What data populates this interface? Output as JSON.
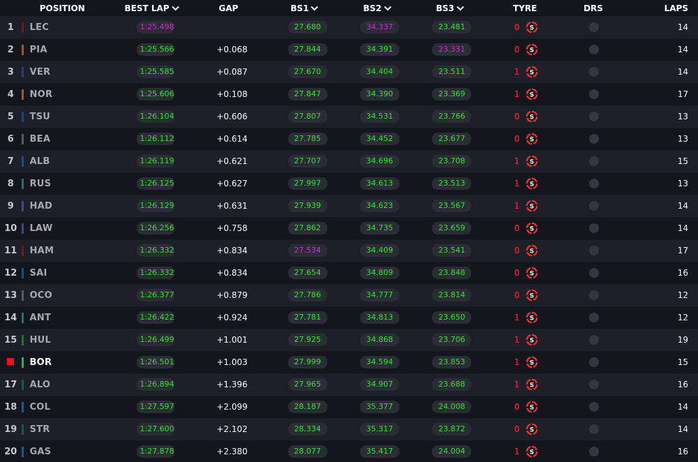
{
  "columns": {
    "position": "POSITION",
    "best_lap": "BEST LAP",
    "gap": "GAP",
    "bs1": "BS1",
    "bs2": "BS2",
    "bs3": "BS3",
    "tyre": "TYRE",
    "drs": "DRS",
    "laps": "LAPS"
  },
  "colors": {
    "green": "#2ce62c",
    "purple": "#d22ad2",
    "tyre_soft": "#ff3030",
    "current_driver_marker": "#ff1010"
  },
  "rows": [
    {
      "pos": "1",
      "team_color": "#7a1020",
      "driver": "LEC",
      "best": "1:25.498",
      "best_c": "purple",
      "gap": "",
      "bs1": "27.680",
      "bs1_c": "green",
      "bs2": "34.337",
      "bs2_c": "purple",
      "bs3": "23.481",
      "bs3_c": "green",
      "tyre_age": "0",
      "tyre_icon": "soft-tyre-icon",
      "laps": "14"
    },
    {
      "pos": "2",
      "team_color": "#a85a10",
      "driver": "PIA",
      "best": "1:25.566",
      "best_c": "green",
      "gap": "+0.068",
      "bs1": "27.844",
      "bs1_c": "green",
      "bs2": "34.391",
      "bs2_c": "green",
      "bs3": "23.331",
      "bs3_c": "purple",
      "tyre_age": "0",
      "tyre_icon": "soft-tyre-icon",
      "laps": "14"
    },
    {
      "pos": "3",
      "team_color": "#24407a",
      "driver": "VER",
      "best": "1:25.585",
      "best_c": "green",
      "gap": "+0.087",
      "bs1": "27.670",
      "bs1_c": "green",
      "bs2": "34.404",
      "bs2_c": "green",
      "bs3": "23.511",
      "bs3_c": "green",
      "tyre_age": "1",
      "tyre_icon": "soft-tyre-icon",
      "laps": "14"
    },
    {
      "pos": "4",
      "team_color": "#a85a10",
      "driver": "NOR",
      "best": "1:25.606",
      "best_c": "green",
      "gap": "+0.108",
      "bs1": "27.847",
      "bs1_c": "green",
      "bs2": "34.390",
      "bs2_c": "green",
      "bs3": "23.369",
      "bs3_c": "green",
      "tyre_age": "1",
      "tyre_icon": "soft-tyre-icon",
      "laps": "17"
    },
    {
      "pos": "5",
      "team_color": "#24407a",
      "driver": "TSU",
      "best": "1:26.104",
      "best_c": "green",
      "gap": "+0.606",
      "bs1": "27.807",
      "bs1_c": "green",
      "bs2": "34.531",
      "bs2_c": "green",
      "bs3": "23.766",
      "bs3_c": "green",
      "tyre_age": "0",
      "tyre_icon": "soft-tyre-icon",
      "laps": "13"
    },
    {
      "pos": "6",
      "team_color": "#5a5a62",
      "driver": "BEA",
      "best": "1:26.112",
      "best_c": "green",
      "gap": "+0.614",
      "bs1": "27.785",
      "bs1_c": "green",
      "bs2": "34.452",
      "bs2_c": "green",
      "bs3": "23.677",
      "bs3_c": "green",
      "tyre_age": "0",
      "tyre_icon": "soft-tyre-icon",
      "laps": "13"
    },
    {
      "pos": "7",
      "team_color": "#1e4a8a",
      "driver": "ALB",
      "best": "1:26.119",
      "best_c": "green",
      "gap": "+0.621",
      "bs1": "27.707",
      "bs1_c": "green",
      "bs2": "34.696",
      "bs2_c": "green",
      "bs3": "23.708",
      "bs3_c": "green",
      "tyre_age": "1",
      "tyre_icon": "soft-tyre-icon",
      "laps": "15"
    },
    {
      "pos": "8",
      "team_color": "#147a6a",
      "driver": "RUS",
      "best": "1:26.125",
      "best_c": "green",
      "gap": "+0.627",
      "bs1": "27.997",
      "bs1_c": "green",
      "bs2": "34.613",
      "bs2_c": "green",
      "bs3": "23.513",
      "bs3_c": "green",
      "tyre_age": "1",
      "tyre_icon": "soft-tyre-icon",
      "laps": "13"
    },
    {
      "pos": "9",
      "team_color": "#3a4a8a",
      "driver": "HAD",
      "best": "1:26.129",
      "best_c": "green",
      "gap": "+0.631",
      "bs1": "27.939",
      "bs1_c": "green",
      "bs2": "34.623",
      "bs2_c": "green",
      "bs3": "23.567",
      "bs3_c": "green",
      "tyre_age": "1",
      "tyre_icon": "soft-tyre-icon",
      "laps": "14"
    },
    {
      "pos": "10",
      "team_color": "#3a4a8a",
      "driver": "LAW",
      "best": "1:26.256",
      "best_c": "green",
      "gap": "+0.758",
      "bs1": "27.862",
      "bs1_c": "green",
      "bs2": "34.735",
      "bs2_c": "green",
      "bs3": "23.659",
      "bs3_c": "green",
      "tyre_age": "0",
      "tyre_icon": "soft-tyre-icon",
      "laps": "14"
    },
    {
      "pos": "11",
      "team_color": "#7a1020",
      "driver": "HAM",
      "best": "1:26.332",
      "best_c": "green",
      "gap": "+0.834",
      "bs1": "27.534",
      "bs1_c": "purple",
      "bs2": "34.409",
      "bs2_c": "green",
      "bs3": "23.541",
      "bs3_c": "green",
      "tyre_age": "0",
      "tyre_icon": "soft-tyre-icon",
      "laps": "17"
    },
    {
      "pos": "12",
      "team_color": "#1e4a8a",
      "driver": "SAI",
      "best": "1:26.332",
      "best_c": "green",
      "gap": "+0.834",
      "bs1": "27.654",
      "bs1_c": "green",
      "bs2": "34.809",
      "bs2_c": "green",
      "bs3": "23.848",
      "bs3_c": "green",
      "tyre_age": "0",
      "tyre_icon": "soft-tyre-icon",
      "laps": "16"
    },
    {
      "pos": "13",
      "team_color": "#5a5a62",
      "driver": "OCO",
      "best": "1:26.377",
      "best_c": "green",
      "gap": "+0.879",
      "bs1": "27.786",
      "bs1_c": "green",
      "bs2": "34.777",
      "bs2_c": "green",
      "bs3": "23.814",
      "bs3_c": "green",
      "tyre_age": "0",
      "tyre_icon": "soft-tyre-icon",
      "laps": "12"
    },
    {
      "pos": "14",
      "team_color": "#147a6a",
      "driver": "ANT",
      "best": "1:26.422",
      "best_c": "green",
      "gap": "+0.924",
      "bs1": "27.781",
      "bs1_c": "green",
      "bs2": "34.813",
      "bs2_c": "green",
      "bs3": "23.650",
      "bs3_c": "green",
      "tyre_age": "1",
      "tyre_icon": "soft-tyre-icon",
      "laps": "12"
    },
    {
      "pos": "15",
      "team_color": "#1a7a2a",
      "driver": "HUL",
      "best": "1:26.499",
      "best_c": "green",
      "gap": "+1.001",
      "bs1": "27.925",
      "bs1_c": "green",
      "bs2": "34.868",
      "bs2_c": "green",
      "bs3": "23.706",
      "bs3_c": "green",
      "tyre_age": "1",
      "tyre_icon": "soft-tyre-icon",
      "laps": "19"
    },
    {
      "pos": "",
      "team_color": "#1fbf2f",
      "driver": "BOR",
      "best": "1:26.501",
      "best_c": "green",
      "gap": "+1.003",
      "bs1": "27.999",
      "bs1_c": "green",
      "bs2": "34.594",
      "bs2_c": "green",
      "bs3": "23.853",
      "bs3_c": "green",
      "tyre_age": "1",
      "tyre_icon": "soft-tyre-icon",
      "laps": "15",
      "current": true
    },
    {
      "pos": "17",
      "team_color": "#1a5a3a",
      "driver": "ALO",
      "best": "1:26.894",
      "best_c": "green",
      "gap": "+1.396",
      "bs1": "27.965",
      "bs1_c": "green",
      "bs2": "34.907",
      "bs2_c": "green",
      "bs3": "23.688",
      "bs3_c": "green",
      "tyre_age": "1",
      "tyre_icon": "soft-tyre-icon",
      "laps": "16"
    },
    {
      "pos": "18",
      "team_color": "#14607a",
      "driver": "COL",
      "best": "1:27.597",
      "best_c": "green",
      "gap": "+2.099",
      "bs1": "28.187",
      "bs1_c": "green",
      "bs2": "35.377",
      "bs2_c": "green",
      "bs3": "24.008",
      "bs3_c": "green",
      "tyre_age": "0",
      "tyre_icon": "soft-tyre-icon",
      "laps": "14"
    },
    {
      "pos": "19",
      "team_color": "#1a5a3a",
      "driver": "STR",
      "best": "1:27.600",
      "best_c": "green",
      "gap": "+2.102",
      "bs1": "28.334",
      "bs1_c": "green",
      "bs2": "35.317",
      "bs2_c": "green",
      "bs3": "23.872",
      "bs3_c": "green",
      "tyre_age": "0",
      "tyre_icon": "soft-tyre-icon",
      "laps": "14"
    },
    {
      "pos": "20",
      "team_color": "#14607a",
      "driver": "GAS",
      "best": "1:27.878",
      "best_c": "green",
      "gap": "+2.380",
      "bs1": "28.077",
      "bs1_c": "green",
      "bs2": "35.417",
      "bs2_c": "green",
      "bs3": "24.004",
      "bs3_c": "green",
      "tyre_age": "1",
      "tyre_icon": "soft-tyre-icon",
      "laps": "16"
    }
  ]
}
